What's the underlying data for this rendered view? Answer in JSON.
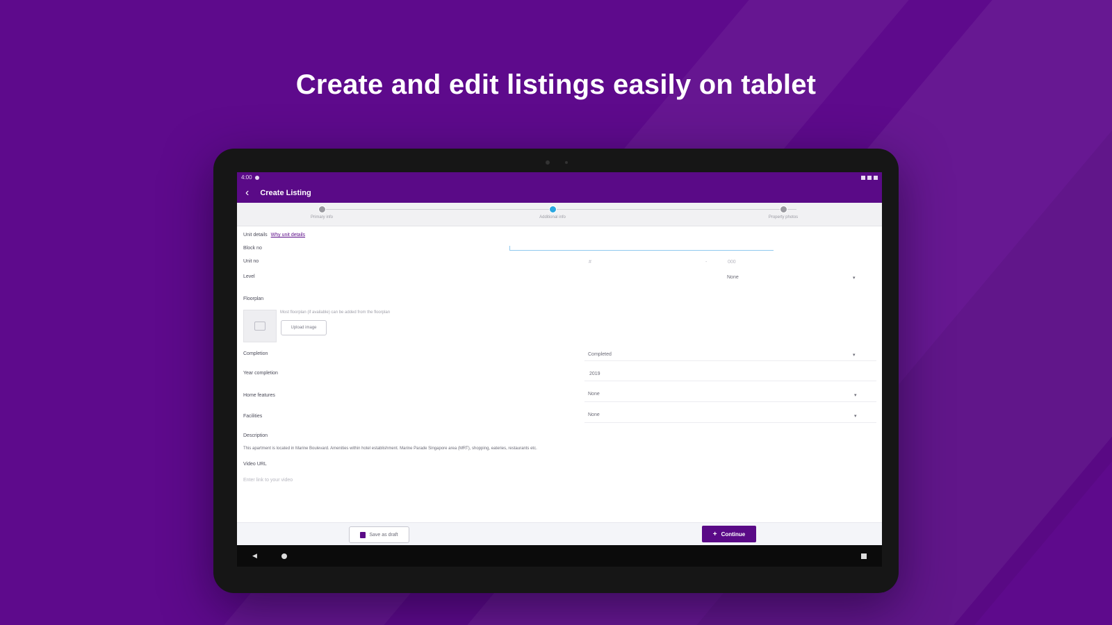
{
  "headline": "Create and edit listings easily on tablet",
  "colors": {
    "brand": "#5a0a87",
    "background": "#5e0a8c",
    "step_active": "#2aa7e0"
  },
  "status_bar": {
    "time": "4:00"
  },
  "app_bar": {
    "back_icon": "arrow-left-icon",
    "title": "Create Listing"
  },
  "stepper": {
    "steps": [
      {
        "label": "Primary info",
        "state": "done"
      },
      {
        "label": "Additional info",
        "state": "active"
      },
      {
        "label": "Property photos",
        "state": "pending"
      }
    ]
  },
  "form": {
    "unit_details": {
      "label": "Unit details",
      "link": "Why unit details"
    },
    "block_no": {
      "label": "Block no",
      "value": ""
    },
    "unit_no": {
      "label": "Unit no",
      "sep": "#",
      "dash": "-",
      "part2": "000"
    },
    "level": {
      "label": "Level",
      "value": "None"
    },
    "floorplan": {
      "label": "Floorplan",
      "note": "Most floorplan (if available) can be added from the floorplan",
      "upload_label": "Upload image"
    },
    "completion": {
      "label": "Completion",
      "value": "Completed"
    },
    "year_completion": {
      "label": "Year completion",
      "value": "2019"
    },
    "home_features": {
      "label": "Home features",
      "value": "None"
    },
    "facilities": {
      "label": "Facilities",
      "value": "None"
    },
    "description": {
      "label": "Description",
      "value": "This apartment is located in Marine Boulevard. Amenities within hotel establishment. Marine Parade Singapore area (MRT), shopping, eateries, restaurants etc."
    },
    "video_url": {
      "label": "Video URL",
      "placeholder": "Enter link to your video"
    }
  },
  "bottom_bar": {
    "save_draft_label": "Save as draft",
    "continue_label": "Continue"
  }
}
